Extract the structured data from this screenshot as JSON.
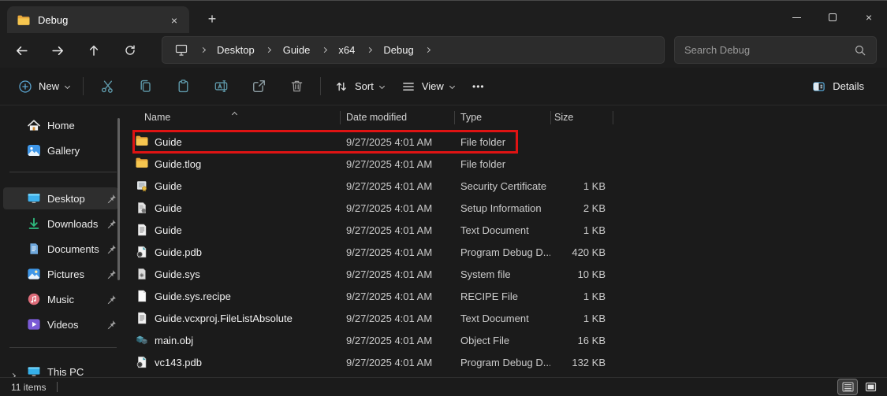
{
  "colors": {
    "accent_blue": "#4cc2ff",
    "folder_yellow": "#f6c64f",
    "annotation_red": "#df1313",
    "toolbar_teal": "#5f9aab"
  },
  "glyphs": {
    "close": "×",
    "new_tab": "+",
    "more_dots": "•••"
  },
  "tab_bar": {
    "tab_title": "Debug"
  },
  "navigation": {
    "breadcrumb": [
      "Desktop",
      "Guide",
      "x64",
      "Debug"
    ],
    "search_placeholder": "Search Debug"
  },
  "toolbar": {
    "new_label": "New",
    "sort_label": "Sort",
    "view_label": "View",
    "details_label": "Details"
  },
  "sidebar": {
    "items": [
      {
        "label": "Home",
        "pinned": false
      },
      {
        "label": "Gallery",
        "pinned": false
      },
      {
        "label": "Desktop",
        "pinned": true,
        "selected": true
      },
      {
        "label": "Downloads",
        "pinned": true
      },
      {
        "label": "Documents",
        "pinned": true
      },
      {
        "label": "Pictures",
        "pinned": true
      },
      {
        "label": "Music",
        "pinned": true
      },
      {
        "label": "Videos",
        "pinned": true
      },
      {
        "label": "This PC",
        "pinned": false
      }
    ]
  },
  "file_list": {
    "columns": [
      "Name",
      "Date modified",
      "Type",
      "Size"
    ],
    "rows": [
      {
        "name": "Guide",
        "date": "9/27/2025 4:01 AM",
        "type": "File folder",
        "size": "",
        "icon": "folder",
        "annotated": true
      },
      {
        "name": "Guide.tlog",
        "date": "9/27/2025 4:01 AM",
        "type": "File folder",
        "size": "",
        "icon": "folder"
      },
      {
        "name": "Guide",
        "date": "9/27/2025 4:01 AM",
        "type": "Security Certificate",
        "size": "1 KB",
        "icon": "certificate"
      },
      {
        "name": "Guide",
        "date": "9/27/2025 4:01 AM",
        "type": "Setup Information",
        "size": "2 KB",
        "icon": "setup-information"
      },
      {
        "name": "Guide",
        "date": "9/27/2025 4:01 AM",
        "type": "Text Document",
        "size": "1 KB",
        "icon": "text-document"
      },
      {
        "name": "Guide.pdb",
        "date": "9/27/2025 4:01 AM",
        "type": "Program Debug D...",
        "size": "420 KB",
        "icon": "pdb"
      },
      {
        "name": "Guide.sys",
        "date": "9/27/2025 4:01 AM",
        "type": "System file",
        "size": "10 KB",
        "icon": "system-file"
      },
      {
        "name": "Guide.sys.recipe",
        "date": "9/27/2025 4:01 AM",
        "type": "RECIPE File",
        "size": "1 KB",
        "icon": "blank-document"
      },
      {
        "name": "Guide.vcxproj.FileListAbsolute",
        "date": "9/27/2025 4:01 AM",
        "type": "Text Document",
        "size": "1 KB",
        "icon": "text-document"
      },
      {
        "name": "main.obj",
        "date": "9/27/2025 4:01 AM",
        "type": "Object File",
        "size": "16 KB",
        "icon": "object-file"
      },
      {
        "name": "vc143.pdb",
        "date": "9/27/2025 4:01 AM",
        "type": "Program Debug D...",
        "size": "132 KB",
        "icon": "pdb"
      }
    ]
  },
  "status_bar": {
    "items_count": "11 items"
  }
}
